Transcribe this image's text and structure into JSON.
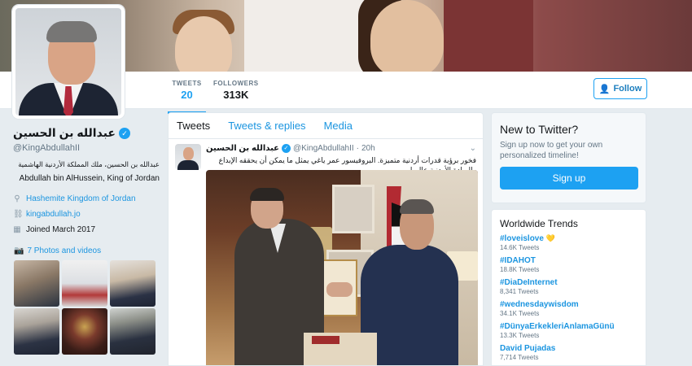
{
  "profile": {
    "name": "عبدالله بن الحسين",
    "handle": "@KingAbdullahII",
    "bio_ar": "عبدالله بن الحسين، ملك المملكة الأردنية الهاشمية",
    "bio_en": "Abdullah bin AlHussein, King of Jordan",
    "location": "Hashemite Kingdom of Jordan",
    "website": "kingabdullah.jo",
    "joined": "Joined March 2017",
    "photos_link": "7 Photos and videos",
    "verified_glyph": "✓"
  },
  "stats": {
    "tweets_label": "TWEETS",
    "tweets_value": "20",
    "followers_label": "FOLLOWERS",
    "followers_value": "313K"
  },
  "follow_button": {
    "label": "Follow",
    "icon": "add-user-icon"
  },
  "tabs": [
    "Tweets",
    "Tweets & replies",
    "Media"
  ],
  "tweet": {
    "name": "عبدالله بن الحسين",
    "handle": "@KingAbdullahII",
    "dot": "·",
    "time": "20h",
    "text": "فخور برؤية قدرات أردنية متميزة. البروفيسور عمر ياغي يمثل ما يمكن أن يحققه الإبداع والريادة الأردنية عالميا"
  },
  "signup": {
    "title": "New to Twitter?",
    "text": "Sign up now to get your own personalized timeline!",
    "button": "Sign up"
  },
  "trends": {
    "title": "Worldwide Trends",
    "items": [
      {
        "name": "#loveislove",
        "count": "14.6K Tweets",
        "emoji": "💛"
      },
      {
        "name": "#IDAHOT",
        "count": "18.8K Tweets"
      },
      {
        "name": "#DiaDeInternet",
        "count": "8,341 Tweets"
      },
      {
        "name": "#wednesdaywisdom",
        "count": "34.1K Tweets"
      },
      {
        "name": "#DünyaErkekleriAnlamaGünü",
        "count": "13.3K Tweets"
      },
      {
        "name": "David Pujadas",
        "count": "7,714 Tweets"
      }
    ]
  },
  "colors": {
    "accent": "#1da1f2",
    "link": "#1b95e0",
    "background": "#e6ecf0"
  }
}
